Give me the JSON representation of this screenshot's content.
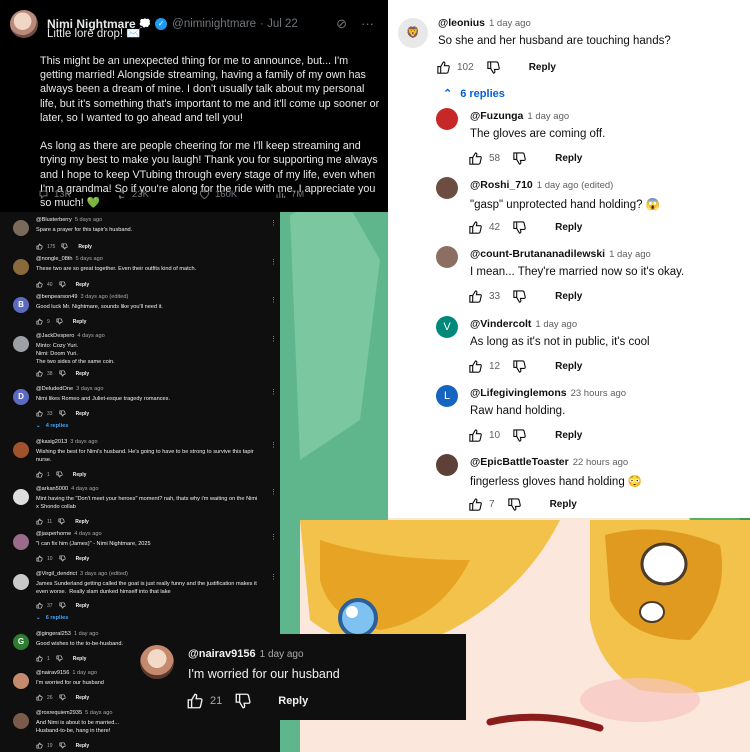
{
  "tweet": {
    "name": "Nimi Nightmare",
    "emoji_after_name": "💭",
    "handle": "@niminightmare",
    "date": "· Jul 22",
    "first_line": "Little lore drop! ✉️",
    "body": "This might be an unexpected thing for me to announce, but... I'm getting married! Alongside streaming, having a family of my own has always been a dream of mine. I don't usually talk about my personal life, but it's something that's important to me and it'll come up sooner or later, so I wanted to go ahead and tell you!\n\nAs long as there are people cheering for me I'll keep streaming and trying my best to make you laugh! Thank you for supporting me always and I hope to keep VTubing through every stage of my life, even when I'm a grandma! So if you're along for the ride with me, I appreciate you so much! 💚",
    "stats": {
      "replies": "13K",
      "reposts": "23K",
      "likes": "160K",
      "views": "7M"
    }
  },
  "left_comments": [
    {
      "user": "@Blusterberry",
      "time": "5 days ago",
      "text": "Spare a prayer for this tapir's husband.",
      "likes": "175",
      "avatar_color": "#7a6a5c"
    },
    {
      "user": "@nongle_08th",
      "time": "5 days ago",
      "text": "These two are so great together. Even their outfits kind of match.",
      "likes": "40",
      "avatar_color": "#8a6a3a"
    },
    {
      "user": "@benpearson49",
      "time": "3 days ago (edited)",
      "text": "Good luck Mr. Nightmare, sounds like you'll need it.",
      "likes": "9",
      "avatar_letter": "B",
      "avatar_color": "#5c6bc0"
    },
    {
      "user": "@JackDespero",
      "time": "4 days ago",
      "text": "Minto: Cozy Yuri.\nNimi: Doom Yuri.\nThe two sides of the same coin.",
      "likes": "38",
      "avatar_color": "#9aa0a6"
    },
    {
      "user": "@DeludedOne",
      "time": "3 days ago",
      "text": "Nimi likes Romeo and Juliet-esque tragedy romances.",
      "likes": "33",
      "avatar_letter": "D",
      "avatar_color": "#5c6bc0",
      "replies": "4 replies"
    },
    {
      "user": "@kasig2013",
      "time": "3 days ago",
      "text": "Wishing the best for Nimi's husband. He's going to have to be strong to survive this tapir nurse.",
      "likes": "1",
      "avatar_color": "#a0522d"
    },
    {
      "user": "@arkan5000",
      "time": "4 days ago",
      "text": "Mint having the \"Don't meet your heroes\" moment? nah, thats why i'm waiting on the Nimi x Shondo collab",
      "likes": "11",
      "avatar_color": "#dddddd"
    },
    {
      "user": "@jasperhorne",
      "time": "4 days ago",
      "text": "\"I can fix him (James)\" - Nimi Nightmare, 2025",
      "likes": "10",
      "avatar_color": "#9b6b8a"
    },
    {
      "user": "@Virgil_dendrict",
      "time": "3 days ago (edited)",
      "text": "James Sunderland getting called the goat is just really funny and the justification makes it even worse.  Really slam dunked himself into that lake",
      "likes": "37",
      "avatar_color": "#c9c9c9",
      "replies": "6 replies"
    },
    {
      "user": "@gingeral253",
      "time": "1 day ago",
      "text": "Good wishes to the to-be-husband.",
      "likes": "1",
      "avatar_letter": "G",
      "avatar_color": "#2e7d32"
    },
    {
      "user": "@nairav9156",
      "time": "1 day ago",
      "text": "I'm worried for our husband",
      "likes": "26",
      "avatar_color": "#c58a6e"
    },
    {
      "user": "@roxrequiem2935",
      "time": "5 days ago",
      "text": "And Nimi is about to be married...\nHusband-to-be, hang in there!",
      "likes": "19",
      "avatar_color": "#7a5a4a"
    }
  ],
  "right_main": {
    "user": "@leonius",
    "time": "1 day ago",
    "text": "So she and her husband are touching hands?",
    "likes": "102",
    "reply_label": "Reply",
    "replies_label": "6 replies"
  },
  "right_replies": [
    {
      "user": "@Fuzunga",
      "time": "1 day ago",
      "text": "The gloves are coming off.",
      "likes": "58",
      "avatar_color": "#c62828"
    },
    {
      "user": "@Roshi_710",
      "time": "1 day ago (edited)",
      "text": "\"gasp\" unprotected hand holding? 😱",
      "likes": "42",
      "avatar_color": "#6d4c41"
    },
    {
      "user": "@count-Brutananadilewski",
      "time": "1 day ago",
      "text": "I mean... They're married now so it's okay.",
      "likes": "33",
      "avatar_color": "#8d6e63"
    },
    {
      "user": "@Vindercolt",
      "time": "1 day ago",
      "text": "As long as it's not in public, it's cool",
      "likes": "12",
      "avatar_letter": "V",
      "avatar_color": "#00897b"
    },
    {
      "user": "@Lifegivinglemons",
      "time": "23 hours ago",
      "text": "Raw hand holding.",
      "likes": "10",
      "avatar_letter": "L",
      "avatar_color": "#1565c0"
    },
    {
      "user": "@EpicBattleToaster",
      "time": "22 hours ago",
      "text": "fingerless gloves hand holding 😳",
      "likes": "7",
      "avatar_color": "#5d4037"
    }
  ],
  "bottom_comment": {
    "user": "@nairav9156",
    "time": "1 day ago",
    "text": "I'm worried for our husband",
    "likes": "21",
    "reply_label": "Reply"
  },
  "labels": {
    "reply": "Reply"
  }
}
